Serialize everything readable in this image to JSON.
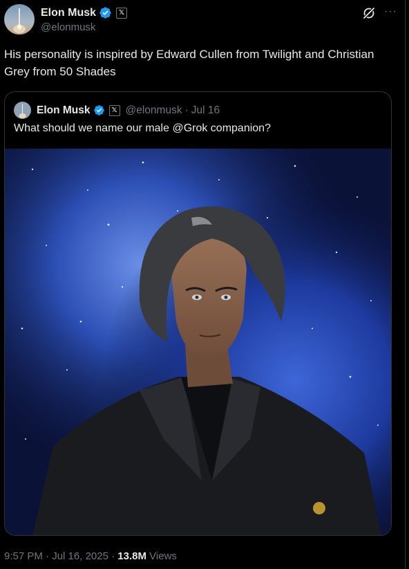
{
  "author": {
    "display_name": "Elon Musk",
    "handle": "@elonmusk",
    "verified_icon": "verified-badge-icon",
    "affiliation_icon": "x-logo-icon",
    "affiliation_glyph": "𝕏"
  },
  "tweet": {
    "text": "His personality is inspired by Edward Cullen from Twilight and Christian Grey from 50 Shades"
  },
  "header_icons": {
    "grok": "grok-icon",
    "more": "more-options-icon",
    "more_glyph": "···"
  },
  "quote": {
    "display_name": "Elon Musk",
    "handle": "@elonmusk",
    "separator": "·",
    "date": "Jul 16",
    "text": "What should we name our male @Grok companion?",
    "image": "anime-style dark-haired man in black suit against starry blue nebula"
  },
  "meta": {
    "time": "9:57 PM",
    "sep1": " · ",
    "date": "Jul 16, 2025",
    "sep2": " · ",
    "views_count": "13.8M",
    "views_label": " Views"
  },
  "colors": {
    "background": "#000000",
    "text": "#e7e9ea",
    "secondary": "#71767b",
    "border": "#2f3336",
    "verified": "#1d9bf0"
  }
}
